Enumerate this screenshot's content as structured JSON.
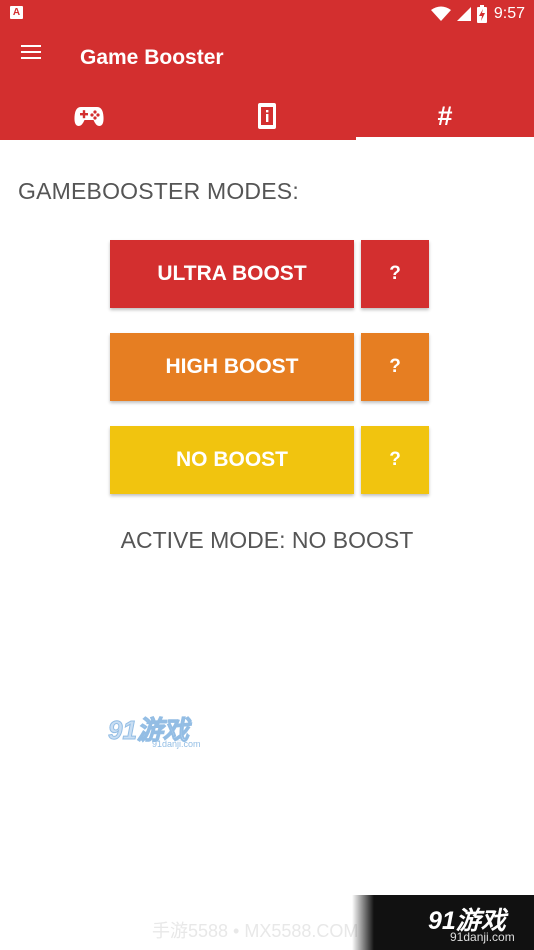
{
  "status_bar": {
    "left_icon_letter": "A",
    "time": "9:57"
  },
  "app_bar": {
    "title": "Game Booster"
  },
  "tabs": [
    {
      "icon": "gamepad-icon",
      "selected": false
    },
    {
      "icon": "phone-info-icon",
      "selected": false
    },
    {
      "icon": "hash-icon",
      "label": "#",
      "selected": true
    }
  ],
  "content": {
    "heading": "GAMEBOOSTER MODES:",
    "modes": [
      {
        "label": "ULTRA BOOST",
        "help": "?",
        "color": "#d32f2f"
      },
      {
        "label": "HIGH BOOST",
        "help": "?",
        "color": "#e67e22"
      },
      {
        "label": "NO BOOST",
        "help": "?",
        "color": "#f1c40f"
      }
    ],
    "active_mode": "ACTIVE MODE: NO BOOST"
  },
  "watermarks": {
    "logo_text": "91游戏",
    "logo_sub": "91danji.com",
    "bottom_text": "手游5588 • MX5588.COM",
    "corner_title": "91游戏",
    "corner_sub": "91danji.com"
  },
  "colors": {
    "primary": "#d32f2f",
    "ultra": "#d32f2f",
    "high": "#e67e22",
    "none": "#f1c40f",
    "text": "#555555"
  }
}
